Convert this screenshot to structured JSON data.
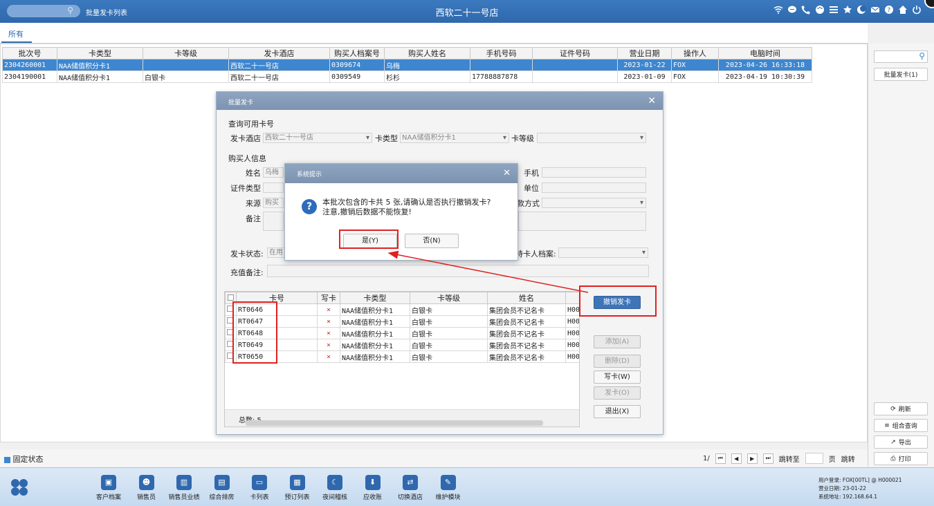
{
  "topbar": {
    "page_title": "批量发卡列表",
    "hotel_name": "西软二十一号店",
    "icons": [
      "wifi-icon",
      "chat-icon",
      "phone-icon",
      "palette-icon",
      "menu-icon",
      "star-icon",
      "moon-icon",
      "mail-icon",
      "help-icon",
      "home-icon",
      "power-icon"
    ]
  },
  "tabs": {
    "all": "所有"
  },
  "main_grid": {
    "headers": [
      "批次号",
      "卡类型",
      "卡等级",
      "发卡酒店",
      "购买人档案号",
      "购买人姓名",
      "手机号码",
      "证件号码",
      "营业日期",
      "操作人",
      "电脑时间"
    ],
    "rows": [
      [
        "2304260001",
        "NAA储值积分卡1",
        "",
        "西软二十一号店",
        "0309674",
        "乌梅",
        "",
        "",
        "2023-01-22",
        "FOX",
        "2023-04-26 16:33:18"
      ],
      [
        "2304190001",
        "NAA储值积分卡1",
        "白银卡",
        "西软二十一号店",
        "0309549",
        "杉杉",
        "17788887878",
        "",
        "2023-01-09",
        "FOX",
        "2023-04-19 10:30:39"
      ]
    ]
  },
  "right_panel": {
    "batch_button": "批量发卡(1)",
    "refresh": "刷新",
    "combo_query": "组合查询",
    "export": "导出",
    "print": "打印"
  },
  "statusbar": {
    "fixed_state": "固定状态",
    "page_info": "1/",
    "jump_to": "跳转至",
    "page_unit": "页",
    "jump_button": "跳转"
  },
  "taskbar": {
    "items": [
      "客户档案",
      "销售员",
      "销售员业绩",
      "综合排房",
      "卡列表",
      "预订列表",
      "夜间稽核",
      "应收账",
      "切换酒店",
      "维护模块"
    ],
    "sys_user": "用户登录:  FOX[00TL] @ H000021",
    "sys_date": "营业日期:  23-01-22",
    "sys_addr": "系统地址:  192.168.64.1"
  },
  "dialog": {
    "title": "批量发卡",
    "query_section": "查询可用卡号",
    "hotel_label": "发卡酒店",
    "hotel_value": "西软二十一号店",
    "cardtype_label": "卡类型",
    "cardtype_value": "NAA储值积分卡1",
    "cardlevel_label": "卡等级",
    "buyer_section": "购买人信息",
    "name_label": "姓名",
    "name_value": "乌梅",
    "phone_label": "手机",
    "idtype_label": "证件类型",
    "company_label": "单位",
    "source_label": "来源",
    "source_value": "购买",
    "pay_label": "款方式",
    "remark_label": "备注",
    "status_label": "发卡状态:",
    "status_value": "在用",
    "holder_label": "持卡人档案:",
    "recharge_label": "充值备注:",
    "grid_headers": [
      "卡号",
      "写卡",
      "卡类型",
      "卡等级",
      "姓名"
    ],
    "cards": [
      {
        "no": "RT0646",
        "write": "×",
        "type": "NAA储值积分卡1",
        "level": "白银卡",
        "name": "集团会员不记名卡",
        "code": "H000"
      },
      {
        "no": "RT0647",
        "write": "×",
        "type": "NAA储值积分卡1",
        "level": "白银卡",
        "name": "集团会员不记名卡",
        "code": "H000"
      },
      {
        "no": "RT0648",
        "write": "×",
        "type": "NAA储值积分卡1",
        "level": "白银卡",
        "name": "集团会员不记名卡",
        "code": "H000"
      },
      {
        "no": "RT0649",
        "write": "×",
        "type": "NAA储值积分卡1",
        "level": "白银卡",
        "name": "集团会员不记名卡",
        "code": "H000"
      },
      {
        "no": "RT0650",
        "write": "×",
        "type": "NAA储值积分卡1",
        "level": "白银卡",
        "name": "集团会员不记名卡",
        "code": "H000"
      }
    ],
    "total": "总数:  5",
    "btn_revoke": "撤销发卡",
    "btn_add": "添加(A)",
    "btn_delete": "删除(D)",
    "btn_write": "写卡(W)",
    "btn_issue": "发卡(O)",
    "btn_exit": "退出(X)"
  },
  "confirm": {
    "title": "系统提示",
    "message_line1": "本批次包含的卡共 5 张,请确认是否执行撤销发卡?",
    "message_line2": "注意,撤销后数据不能恢复!",
    "yes": "是(Y)",
    "no": "否(N)"
  },
  "colors": {
    "header_blue": "#2f68ad",
    "selected_row": "#3e86cf",
    "annotation_red": "#e02020"
  }
}
